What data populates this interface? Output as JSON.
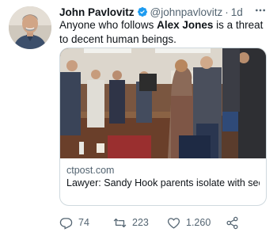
{
  "tweet": {
    "author": {
      "display_name": "John Pavlovitz",
      "handle": "@johnpavlovitz",
      "separator": "·",
      "time": "1d",
      "verified_icon": "verified-badge-icon",
      "avatar": "avatar"
    },
    "text": {
      "part1": "Anyone who follows ",
      "bold": "Alex Jones",
      "part2": " is a threat to decent human beings."
    },
    "card": {
      "domain": "ctpost.com",
      "title": "Lawyer: Sandy Hook parents isolate with security due to safety concerns during Texa..."
    },
    "actions": {
      "replies": "74",
      "retweets": "223",
      "likes": "1.260",
      "reply_icon": "reply-icon",
      "retweet_icon": "retweet-icon",
      "like_icon": "heart-icon",
      "share_icon": "share-icon"
    },
    "colors": {
      "text": "#0f1419",
      "secondary": "#536471",
      "verified": "#1d9bf0",
      "border": "#cfd9de"
    }
  }
}
